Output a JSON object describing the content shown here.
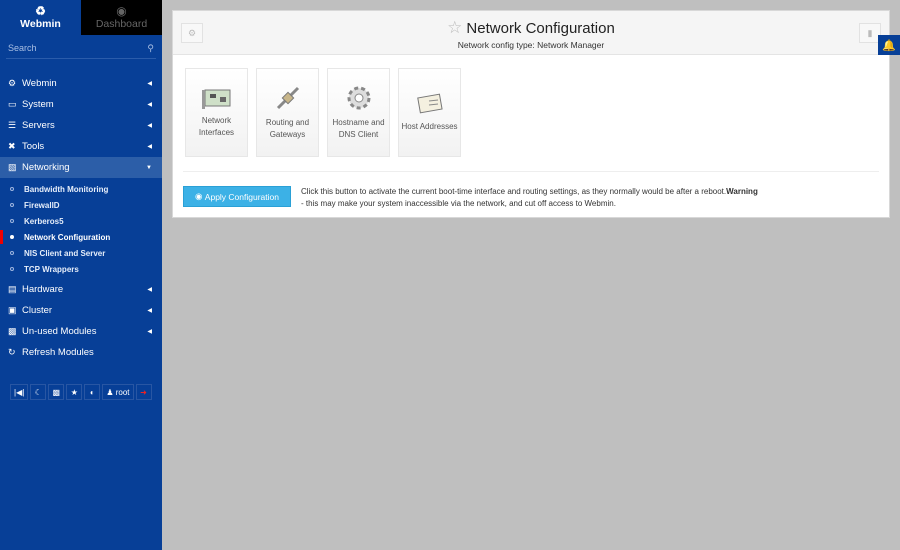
{
  "sidebar": {
    "tabs": [
      {
        "label": "Webmin",
        "icon": "webmin-logo-icon"
      },
      {
        "label": "Dashboard",
        "icon": "dashboard-gauge-icon"
      }
    ],
    "search_placeholder": "Search",
    "items": [
      {
        "label": "Webmin",
        "icon": "gear-icon"
      },
      {
        "label": "System",
        "icon": "laptop-icon"
      },
      {
        "label": "Servers",
        "icon": "server-icon"
      },
      {
        "label": "Tools",
        "icon": "wrench-icon"
      },
      {
        "label": "Networking",
        "icon": "network-icon"
      }
    ],
    "sub_items": [
      "Bandwidth Monitoring",
      "FirewallD",
      "Kerberos5",
      "Network Configuration",
      "NIS Client and Server",
      "TCP Wrappers"
    ],
    "items_after": [
      {
        "label": "Hardware",
        "icon": "hdd-icon"
      },
      {
        "label": "Cluster",
        "icon": "cluster-icon"
      },
      {
        "label": "Un-used Modules",
        "icon": "puzzle-icon"
      },
      {
        "label": "Refresh Modules",
        "icon": "refresh-icon"
      }
    ],
    "user": "root"
  },
  "header": {
    "title": "Network Configuration",
    "subtitle": "Network config type: Network Manager"
  },
  "tiles": [
    {
      "line1": "Network",
      "line2": "Interfaces"
    },
    {
      "line1": "Routing and",
      "line2": "Gateways"
    },
    {
      "line1": "Hostname and",
      "line2": "DNS Client"
    },
    {
      "line1": "Host Addresses",
      "line2": ""
    }
  ],
  "apply": {
    "label": "Apply Configuration",
    "desc": "Click this button to activate the current boot-time interface and routing settings, as they normally would be after a reboot.",
    "warn": "Warning",
    "desc2": " - this may make your system inaccessible via the network, and cut off access to Webmin."
  }
}
